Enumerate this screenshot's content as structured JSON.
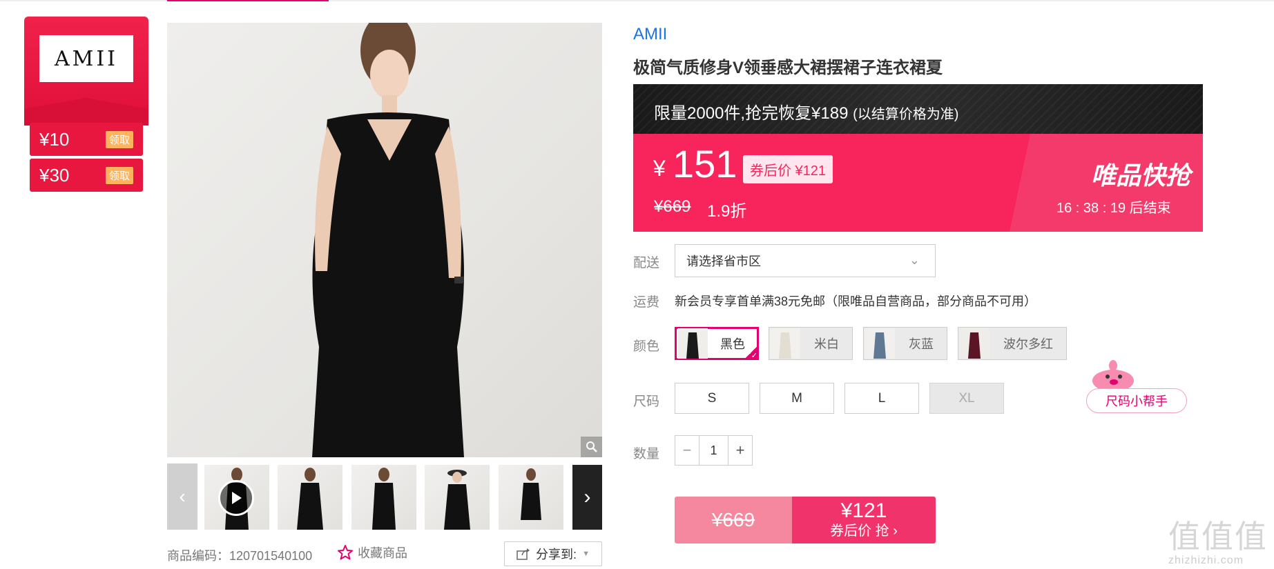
{
  "brand_card": {
    "logo_text": "AMII",
    "coupons": [
      {
        "amount": "¥10",
        "action": "领取"
      },
      {
        "amount": "¥30",
        "action": "领取"
      }
    ]
  },
  "gallery": {
    "product_code_label": "商品编码：",
    "product_code": "120701540100",
    "favorite_label": "收藏商品",
    "share_label": "分享到:"
  },
  "product": {
    "brand": "AMII",
    "title": "极简气质修身V领垂感大裙摆裙子连衣裙夏"
  },
  "promo": {
    "headline": "限量2000件,抢完恢复¥189",
    "note": "(以结算价格为准)"
  },
  "price": {
    "currency": "¥",
    "current": "151",
    "coupon_tag": "券后价 ¥121",
    "original": "¥669",
    "discount": "1.9折",
    "flash_label": "唯品快抢",
    "countdown": "16 : 38 : 19  后结束"
  },
  "delivery": {
    "label": "配送",
    "placeholder": "请选择省市区"
  },
  "shipping": {
    "label": "运费",
    "text": "新会员专享首单满38元免邮（限唯品自营商品，部分商品不可用）"
  },
  "colors": {
    "label": "颜色",
    "options": [
      {
        "name": "黑色",
        "swatch": "#1a1a1a",
        "selected": true
      },
      {
        "name": "米白",
        "swatch": "#e9e4da",
        "selected": false
      },
      {
        "name": "灰蓝",
        "swatch": "#5f7894",
        "selected": false
      },
      {
        "name": "波尔多红",
        "swatch": "#5a1624",
        "selected": false
      }
    ]
  },
  "sizes": {
    "label": "尺码",
    "options": [
      {
        "name": "S",
        "available": true
      },
      {
        "name": "M",
        "available": true
      },
      {
        "name": "L",
        "available": true
      },
      {
        "name": "XL",
        "available": false
      }
    ],
    "helper_label": "尺码小帮手"
  },
  "quantity": {
    "label": "数量",
    "value": "1",
    "minus": "−",
    "plus": "+"
  },
  "buy": {
    "original_price": "¥669",
    "coupon_price": "¥121",
    "coupon_action": "券后价 抢 ›"
  },
  "watermark": {
    "logo": "值值值",
    "site": "zhizhizhi.com"
  },
  "colors_theme": {
    "accent": "#e4006f",
    "price_bg": "#f7255b",
    "link": "#1a73e8"
  }
}
